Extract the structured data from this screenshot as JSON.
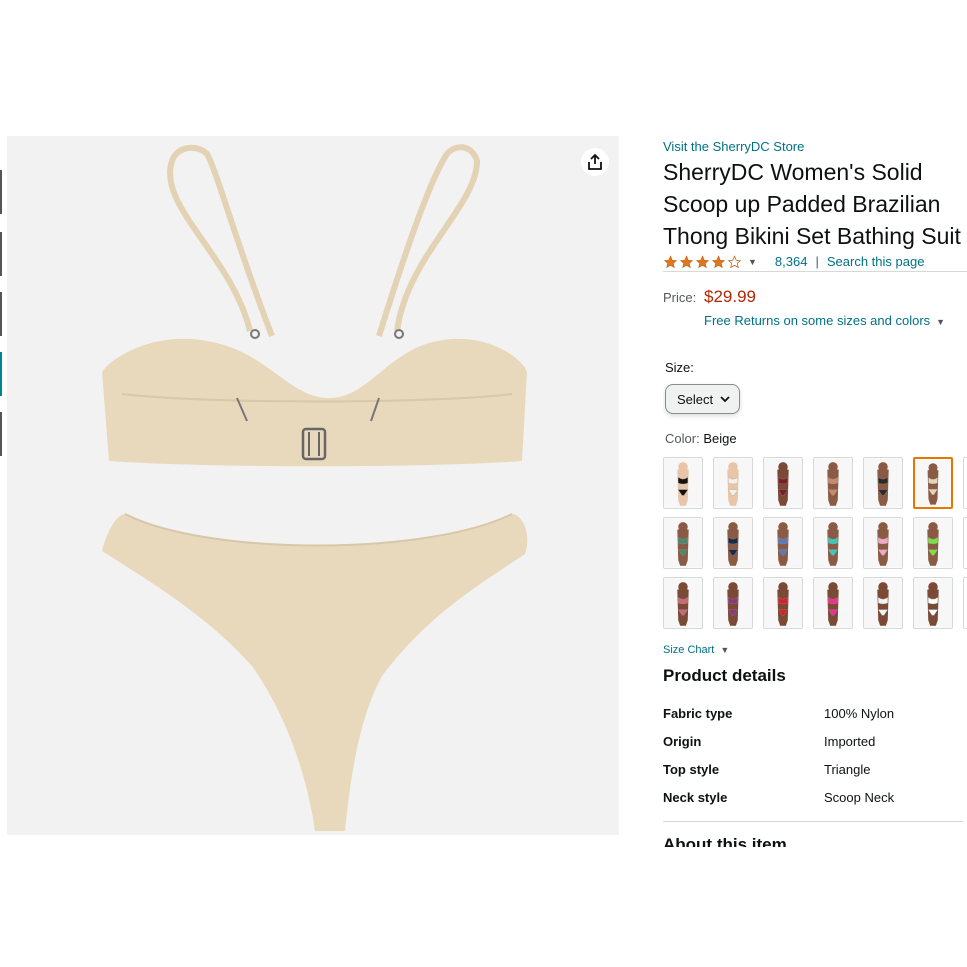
{
  "store_link": "Visit the SherryDC Store",
  "title": "SherryDC Women's Solid Scoop up Padded Brazilian Thong Bikini Set Bathing Suit",
  "rating": {
    "stars": 4.2,
    "count": "8,364",
    "separator": "|",
    "search_link": "Search this page"
  },
  "price": {
    "label": "Price:",
    "value": "$29.99",
    "free_returns": "Free Returns on some sizes and colors"
  },
  "size": {
    "label": "Size:",
    "select_value": "Select"
  },
  "color": {
    "label": "Color:",
    "value": "Beige",
    "swatches": [
      {
        "top": "#111111",
        "bottom": "#111111",
        "skin": "#e8c4a8"
      },
      {
        "top": "#f6f0e8",
        "bottom": "#f6f0e8",
        "skin": "#e8c4a8"
      },
      {
        "top": "#7a1f2a",
        "bottom": "#7a1f2a",
        "skin": "#7a4a36"
      },
      {
        "top": "#c98a6a",
        "bottom": "#c98a6a",
        "skin": "#8a5a44"
      },
      {
        "top": "#2a2a2a",
        "bottom": "#2a2a2a",
        "skin": "#8a5a44"
      },
      {
        "top": "#e6d3b8",
        "bottom": "#e6d3b8",
        "skin": "#8a5a44"
      },
      {
        "top": "#4a8a6a",
        "bottom": "#4a8a6a",
        "skin": "#8a5a44"
      },
      {
        "top": "#1a2a4a",
        "bottom": "#1a2a4a",
        "skin": "#8a5a44"
      },
      {
        "top": "#5a7ac0",
        "bottom": "#5a7ac0",
        "skin": "#8a5a44"
      },
      {
        "top": "#3ec8b8",
        "bottom": "#3ec8b8",
        "skin": "#8a5a44"
      },
      {
        "top": "#f4a8c8",
        "bottom": "#f4a8c8",
        "skin": "#8a5a44"
      },
      {
        "top": "#7be040",
        "bottom": "#7be040",
        "skin": "#8a5a44"
      },
      {
        "top": "#c86a78",
        "bottom": "#c86a78",
        "skin": "#7a4a36"
      },
      {
        "top": "#8a3a7a",
        "bottom": "#8a3a7a",
        "skin": "#7a4a36"
      },
      {
        "top": "#d8202a",
        "bottom": "#d8202a",
        "skin": "#7a4a36"
      },
      {
        "top": "#f0308a",
        "bottom": "#f0308a",
        "skin": "#7a4a36"
      },
      {
        "top": "#f2f2f2",
        "bottom": "#f2f2f2",
        "skin": "#7a4a36"
      },
      {
        "top": "#ffffff",
        "bottom": "#ffffff",
        "skin": "#7a4a36"
      }
    ],
    "selected_index": 5
  },
  "size_chart": "Size Chart",
  "product_details": {
    "heading": "Product details",
    "rows": [
      {
        "key": "Fabric type",
        "value": "100% Nylon"
      },
      {
        "key": "Origin",
        "value": "Imported"
      },
      {
        "key": "Top style",
        "value": "Triangle"
      },
      {
        "key": "Neck style",
        "value": "Scoop Neck"
      }
    ]
  },
  "about_heading": "About this item",
  "colors": {
    "link": "#007185",
    "price": "#b12704",
    "selected_border": "#e77600",
    "star": "#de7921",
    "product_beige": "#e8d9bd"
  }
}
